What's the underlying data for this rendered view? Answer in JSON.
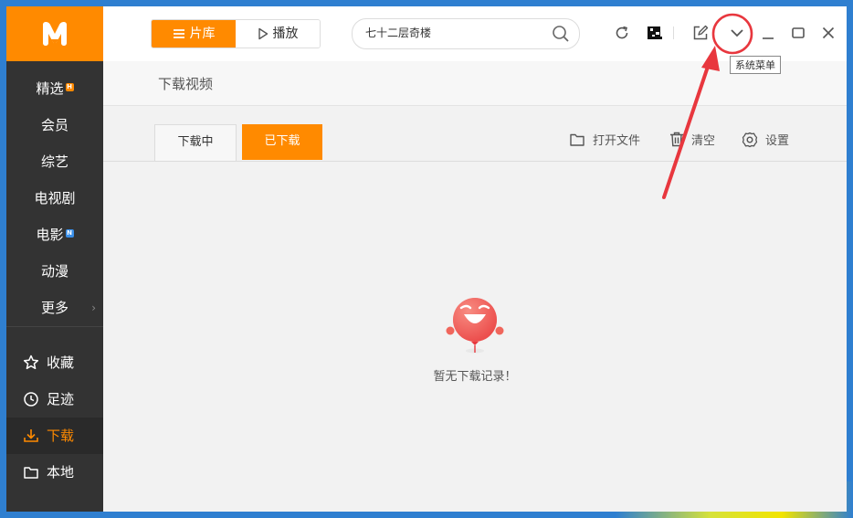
{
  "sidebar": {
    "nav_items": [
      {
        "label": "精选",
        "badge": "H",
        "badge_color": "#ff8a00"
      },
      {
        "label": "会员"
      },
      {
        "label": "综艺"
      },
      {
        "label": "电视剧"
      },
      {
        "label": "电影",
        "badge": "N",
        "badge_color": "#3a8fe8"
      },
      {
        "label": "动漫"
      },
      {
        "label": "更多"
      }
    ],
    "user_items": [
      {
        "label": "收藏",
        "icon": "star-icon"
      },
      {
        "label": "足迹",
        "icon": "clock-icon"
      },
      {
        "label": "下载",
        "icon": "download-icon",
        "active": true
      },
      {
        "label": "本地",
        "icon": "folder-icon"
      }
    ]
  },
  "topbar": {
    "library_label": "片库",
    "play_label": "播放",
    "search_value": "七十二层奇楼",
    "tooltip": "系统菜单"
  },
  "page": {
    "title": "下载视频",
    "tabs": [
      {
        "label": "下载中"
      },
      {
        "label": "已下载",
        "active": true
      }
    ],
    "actions": {
      "open_file": "打开文件",
      "clear": "清空",
      "settings": "设置"
    },
    "empty_text": "暂无下载记录！"
  },
  "colors": {
    "accent": "#ff8a00",
    "sidebar_bg": "#333333",
    "annotation": "#e8373e"
  }
}
